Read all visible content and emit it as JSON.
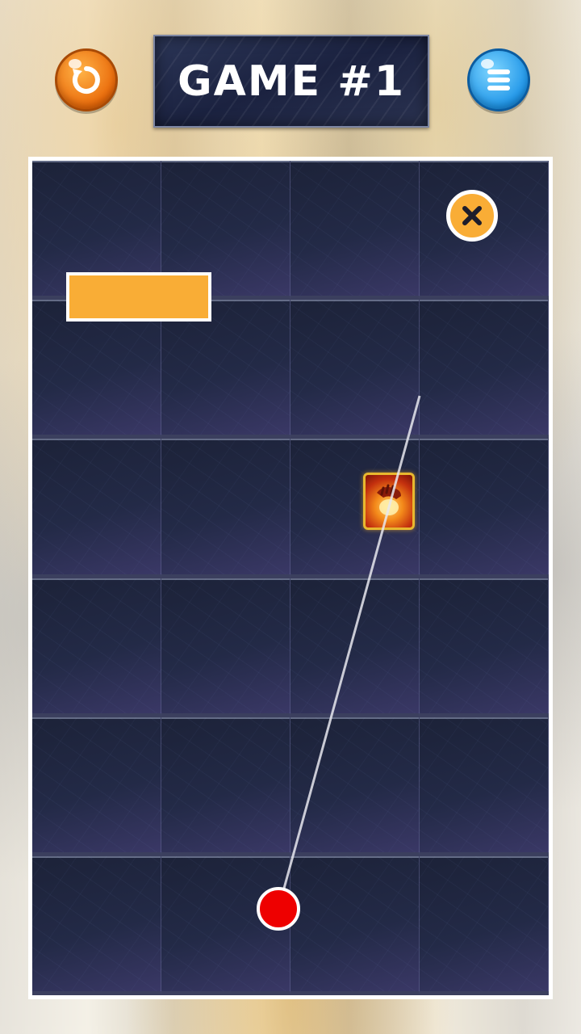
{
  "header": {
    "title": "GAME #1",
    "restart_icon": "restart-icon",
    "menu_icon": "menu-icon"
  },
  "board": {
    "rows": 6,
    "columns": 4,
    "close_icon": "close-icon",
    "card_icon": "fire-hand-card-icon"
  },
  "colors": {
    "accent": "#f9ad36",
    "ball": "#ee0000",
    "restart_button": "#ea6a0a",
    "menu_button": "#1f95e8",
    "tile": "#1f2540"
  }
}
